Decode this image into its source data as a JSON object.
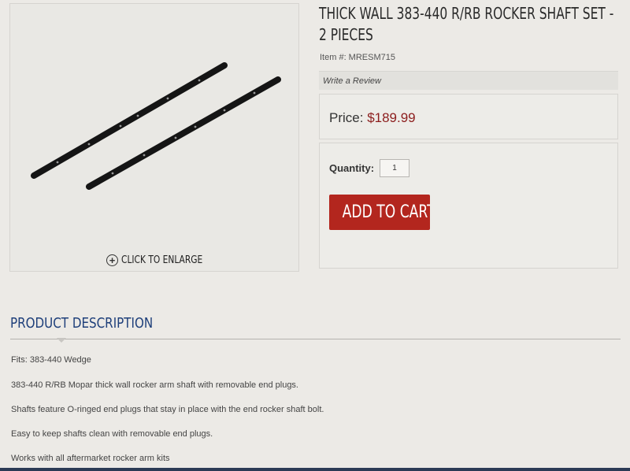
{
  "product": {
    "title": "THICK WALL 383-440 R/RB ROCKER SHAFT SET - 2 PIECES",
    "item_number": "Item #: MRESM715",
    "review_link": "Write a Review",
    "price_label": "Price: ",
    "price_value": "$189.99",
    "quantity_label": "Quantity:",
    "quantity_value": "1",
    "add_to_cart_label": "ADD TO CART",
    "image_alt": "Two black rocker shafts",
    "enlarge_label": "CLICK TO ENLARGE",
    "enlarge_icon": "plus-circle-icon"
  },
  "description": {
    "heading": "PRODUCT DESCRIPTION",
    "lines": [
      "Fits: 383-440 Wedge",
      "383-440 R/RB Mopar thick wall rocker arm shaft with removable end plugs.",
      "Shafts feature O-ringed end plugs that stay in place with the end rocker shaft bolt.",
      "Easy to keep shafts clean with removable end plugs.",
      "Works with all aftermarket rocker arm kits"
    ]
  },
  "colors": {
    "price": "#8c1d1d",
    "add_to_cart_bg": "#b3261e",
    "heading_blue": "#1e3f7a",
    "background": "#eceae6"
  }
}
